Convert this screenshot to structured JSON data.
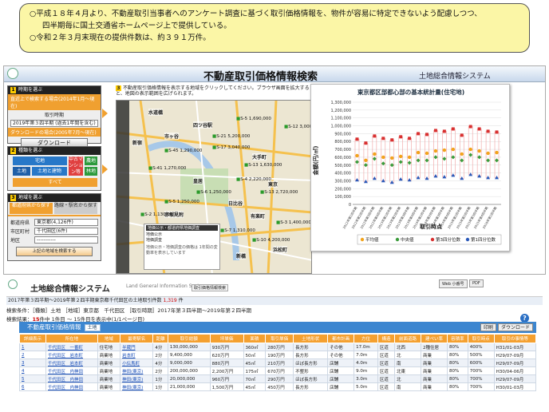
{
  "notice": {
    "lines": [
      "○平成１８年４月より、不動産取引当事者へのアンケート調査に基づく取引価格情報を、物件が容易に特定できないよう配慮しつつ、",
      "四半期毎に国土交通省ホームページ上で提供している。",
      "○令和２年３月末現在の提供件数は、約３９１万件。"
    ]
  },
  "top": {
    "title": "不動産取引価格情報検索",
    "system": "土地総合情報システム"
  },
  "side": {
    "step1": {
      "num": "1",
      "head": "時期を選ぶ",
      "orange": "直近上で検索する場合(2014年1月〜現在)",
      "label": "取引時期",
      "select": "2019年第３四半期  (過去1年間を含む)",
      "orange2": "ダウンロードの場合(2005年7月〜現在)",
      "button": "ダウンロード"
    },
    "step2": {
      "num": "2",
      "head": "種類を選ぶ",
      "tiles": [
        "宅地",
        "土地",
        "土地と建物",
        "中古マンション等",
        "農地",
        "林地",
        "すべて"
      ]
    },
    "step3": {
      "num": "3",
      "head": "地域を選ぶ",
      "tab1": "都道府県から探す",
      "tab2": "路線・駅名から探す",
      "pref_label": "都道府県",
      "pref": "東京都(4,126件)",
      "city_label": "市区町村",
      "city": "千代田区(6件)",
      "area_label": "地区",
      "area": "-----------",
      "button": "上記の地域を検索する"
    }
  },
  "map": {
    "num": "3",
    "hint": "不動産取引価格情報を表示する地域をクリックしてください。ブラウザ画面を拡大すると、地図の表示範囲を広げられます。",
    "labels": [
      "四ツ谷駅",
      "水道橋",
      "新宿",
      "市ヶ谷",
      "皇居",
      "赤坂見附",
      "虎ノ門",
      "東京",
      "大手町",
      "日比谷",
      "有楽町",
      "新橋",
      "浜松町"
    ],
    "prices": [
      "S-45 1,290,000",
      "S-5 1,690,000",
      "S-21 5,200,000",
      "S-17 3,040,000",
      "S-13 1,630,000",
      "S-6 1,250,000",
      "S-13 2,720,000",
      "S-4 2,220,000",
      "S-5 1,250,000",
      "S-2 1,130,000",
      "S-7 1,310,000",
      "S-10 4,200,000",
      "S-3 1,400,000",
      "S-41 1,270,000",
      "S-12 3,000,000"
    ],
    "legend_title": "地価公示・都道府県地価調査",
    "legend": [
      "地価公示",
      "地価調査"
    ],
    "legend_note": "地価公示・地価調査の価格は 1年間の変動率を表示しています"
  },
  "chart_data": {
    "type": "scatter",
    "title": "東京都区部都心部の基本統計量(住宅地)",
    "ylabel": "金額(円/㎡)",
    "xlabel": "取引時点",
    "ylim": [
      0,
      1300000
    ],
    "yticks": [
      0,
      100000,
      200000,
      300000,
      400000,
      500000,
      600000,
      700000,
      800000,
      900000,
      1000000,
      1100000,
      1200000,
      1300000
    ],
    "ytick_labels": [
      "0",
      "100,000",
      "200,000",
      "300,000",
      "400,000",
      "500,000",
      "600,000",
      "700,000",
      "800,000",
      "900,000",
      "1,000,000",
      "1,100,000",
      "1,200,000",
      "1,300,000"
    ],
    "categories": [
      "2012年第1四半期",
      "2012年第2四半期",
      "2012年第3四半期",
      "2012年第4四半期",
      "2013年第1四半期",
      "2013年第2四半期",
      "2013年第3四半期",
      "2013年第4四半期",
      "2014年第1四半期",
      "2014年第2四半期",
      "2014年第3四半期",
      "2014年第4四半期",
      "2015年第1四半期",
      "2015年第2四半期",
      "2015年第3四半期",
      "2015年第4四半期",
      "2016年第1四半期"
    ],
    "series": [
      {
        "name": "平均値",
        "color": "#f2a31c",
        "values": [
          620000,
          560000,
          640000,
          600000,
          590000,
          610000,
          600000,
          660000,
          650000,
          680000,
          690000,
          700000,
          640000,
          700000,
          680000,
          650000,
          660000
        ]
      },
      {
        "name": "中央値",
        "color": "#3c9b3c",
        "values": [
          540000,
          500000,
          580000,
          520000,
          500000,
          540000,
          530000,
          560000,
          560000,
          600000,
          580000,
          600000,
          560000,
          630000,
          600000,
          560000,
          560000
        ]
      },
      {
        "name": "第3四分位数",
        "color": "#d83030",
        "values": [
          830000,
          780000,
          870000,
          840000,
          820000,
          860000,
          840000,
          900000,
          890000,
          940000,
          930000,
          960000,
          880000,
          990000,
          960000,
          930000,
          920000
        ]
      },
      {
        "name": "第1四分位数",
        "color": "#2a58b8",
        "values": [
          310000,
          290000,
          330000,
          300000,
          280000,
          320000,
          310000,
          340000,
          330000,
          360000,
          350000,
          370000,
          330000,
          380000,
          360000,
          340000,
          340000
        ]
      }
    ]
  },
  "lower": {
    "system": "土地総合情報システム",
    "system_en": "Land General Information System",
    "crumb": "取引価格情報検索",
    "btn1": "Web 小番号",
    "btn2": "PDF",
    "bar": "2017年第３四半期〜2019年第２四半期東京都千代田区の土地取引件数",
    "bar_count": "1,319",
    "bar_unit": "件",
    "cond": "検索条件：［種類］土地 ［地域］東京都　千代田区 ［取引時期］2017年第３四半期〜2019年第２四半期",
    "result_prefix": "検索結果：",
    "result_count": "15",
    "result_rest": "件中 1件目 〜 15件目を表示中(1/1ページ目)",
    "table_title": "不動産取引価格情報",
    "table_tag": "土地",
    "dl": "ダウンロード",
    "dl2": "印刷",
    "headers": [
      "詳細表示",
      "所在地",
      "地域",
      "最寄駅名",
      "距離",
      "取引総額",
      "坪単価",
      "面積",
      "取引単価",
      "土地形状",
      "間口",
      "延床面積",
      "建物用途",
      "構造",
      "建築年",
      "前面道路",
      "方位",
      "幅員",
      "都市計画",
      "建ぺい率",
      "容積率",
      "取引時点",
      "取引の事情等"
    ],
    "rows": [
      [
        "1",
        "千代田区　一番町",
        "住宅地",
        "半蔵門",
        "4分",
        "130,000,000",
        "930万円",
        "360㎡",
        "280万円",
        "長方形",
        "その他",
        "17.0m",
        "区道",
        "北西",
        "2種住居",
        "80%",
        "400%",
        "H31/01-03月"
      ],
      [
        "2",
        "千代田区　岩本町",
        "商業地",
        "岩本町",
        "2分",
        "9,400,000",
        "620万円",
        "50㎡",
        "190万円",
        "長方形",
        "その他",
        "7.0m",
        "区道",
        "北",
        "商業",
        "80%",
        "500%",
        "H29/07-09月"
      ],
      [
        "3",
        "千代田区　岩本町",
        "商業地",
        "小伝馬町",
        "4分",
        "9,000,000",
        "880万円",
        "45㎡",
        "210万円",
        "ほぼ長方形",
        "店舗",
        "4.0m",
        "区道",
        "南",
        "商業",
        "80%",
        "600%",
        "H29/07-09月"
      ],
      [
        "4",
        "千代田区　内神田",
        "商業地",
        "神田(東京)",
        "2分",
        "200,000,000",
        "2,200万円",
        "175㎡",
        "670万円",
        "不整形",
        "店舗",
        "9.0m",
        "区道",
        "北東",
        "商業",
        "80%",
        "700%",
        "H30/04-06月"
      ],
      [
        "5",
        "千代田区　内神田",
        "商業地",
        "神田(東京)",
        "1分",
        "20,000,000",
        "960万円",
        "70㎡",
        "290万円",
        "ほぼ長方形",
        "店舗",
        "3.0m",
        "区道",
        "北",
        "商業",
        "80%",
        "700%",
        "H29/07-09月"
      ],
      [
        "6",
        "千代田区　内神田",
        "商業地",
        "神田(東京)",
        "1分",
        "21,000,000",
        "1,500万円",
        "45㎡",
        "450万円",
        "長方形",
        "店舗",
        "5.0m",
        "区道",
        "南",
        "商業",
        "80%",
        "700%",
        "H30/01-03月"
      ]
    ]
  }
}
